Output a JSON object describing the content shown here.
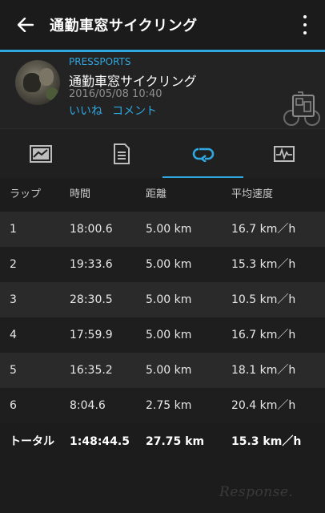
{
  "appbar": {
    "title": "通勤車窓サイクリング"
  },
  "activity": {
    "username": "PRESSPORTS",
    "title": "通勤車窓サイクリング",
    "datetime": "2016/05/08 10:40",
    "like_label": "いいね",
    "comment_label": "コメント"
  },
  "colors": {
    "accent": "#2fa7df",
    "background": "#1c1c1c"
  },
  "tabs": [
    {
      "icon": "summary-chart-icon",
      "active": false
    },
    {
      "icon": "details-list-icon",
      "active": false
    },
    {
      "icon": "laps-loop-icon",
      "active": true
    },
    {
      "icon": "graph-icon",
      "active": false
    }
  ],
  "laps": {
    "headers": [
      "ラップ",
      "時間",
      "距離",
      "平均速度"
    ],
    "rows": [
      [
        "1",
        "18:00.6",
        "5.00 km",
        "16.7 km／h"
      ],
      [
        "2",
        "19:33.6",
        "5.00 km",
        "15.3 km／h"
      ],
      [
        "3",
        "28:30.5",
        "5.00 km",
        "10.5 km／h"
      ],
      [
        "4",
        "17:59.9",
        "5.00 km",
        "16.7 km／h"
      ],
      [
        "5",
        "16:35.2",
        "5.00 km",
        "18.1 km／h"
      ],
      [
        "6",
        "8:04.6",
        "2.75 km",
        "20.4 km／h"
      ]
    ],
    "total": [
      "トータル",
      "1:48:44.5",
      "27.75 km",
      "15.3 km／h"
    ]
  },
  "watermark": "Response."
}
